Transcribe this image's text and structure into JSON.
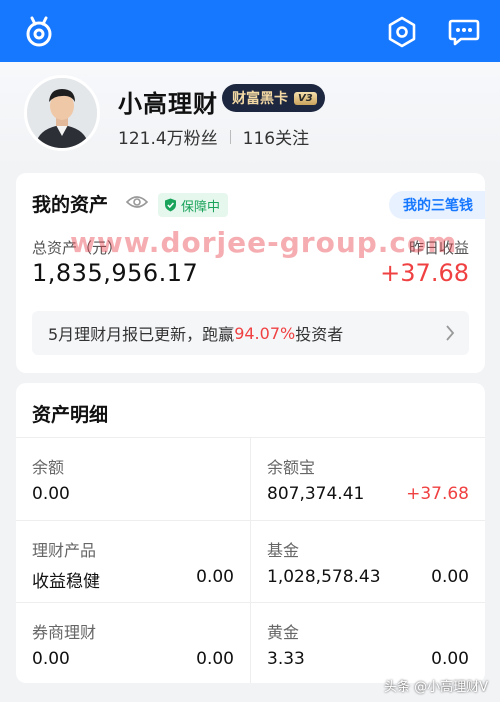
{
  "profile": {
    "nickname": "小高理财",
    "vip_badge": "财富黑卡",
    "vip_level": "V3",
    "fans": "121.4万粉丝",
    "following": "116关注"
  },
  "assets": {
    "title": "我的资产",
    "protect_badge": "保障中",
    "three_cards_link": "我的三笔钱",
    "total_label": "总资产（元）",
    "total_value": "1,835,956.17",
    "yesterday_label": "昨日收益",
    "yesterday_value": "+37.68",
    "report": {
      "prefix": "5月理财月报已更新，跑赢",
      "highlight": "94.07%",
      "suffix": "投资者"
    }
  },
  "detail": {
    "title": "资产明细",
    "items": [
      {
        "name": "余额",
        "value": "0.00",
        "sub": ""
      },
      {
        "name": "余额宝",
        "value": "807,374.41",
        "sub": "+37.68"
      },
      {
        "name": "理财产品",
        "value": "收益稳健",
        "sub": "0.00"
      },
      {
        "name": "基金",
        "value": "1,028,578.43",
        "sub": "0.00"
      },
      {
        "name": "券商理财",
        "value": "0.00",
        "sub": "0.00"
      },
      {
        "name": "黄金",
        "value": "3.33",
        "sub": "0.00"
      }
    ]
  },
  "overlay": {
    "watermark": "www.dorjee-group.com",
    "source_tag": "头条 @小高理财V"
  },
  "colors": {
    "brand_blue": "#1677ff",
    "profit_red": "#f04142",
    "safe_green": "#1aa35a",
    "vip_black": "#1d2740"
  },
  "icons": {
    "logo": "app-logo-icon",
    "settings": "hexagon-settings-icon",
    "message": "message-bubble-icon",
    "eye": "eye-icon",
    "shield": "shield-check-icon",
    "chevron": "chevron-right-icon"
  }
}
